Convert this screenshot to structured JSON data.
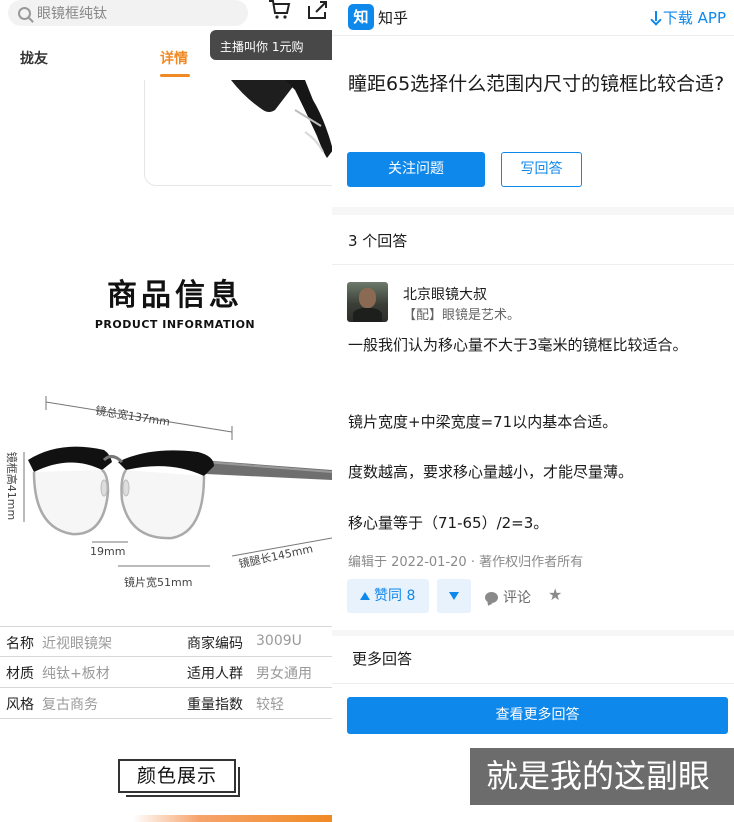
{
  "left_app": {
    "search_placeholder": "眼镜框纯钛",
    "tabs": [
      "拢友",
      "详情"
    ],
    "overlay_text": "主播叫你 1元购",
    "info_title": "商品信息",
    "info_subtitle": "PRODUCT INFORMATION",
    "dimensions": {
      "total_width": "镜总宽137mm",
      "frame_height": "镜框高41mm",
      "bridge": "19mm",
      "lens_width": "镜片宽51mm",
      "temple_length": "镜腿长145mm"
    },
    "specs": [
      {
        "k1": "名称",
        "v1": "近视眼镜架",
        "k2": "商家编码",
        "v2": "3009U"
      },
      {
        "k1": "材质",
        "v1": "纯钛+板材",
        "k2": "适用人群",
        "v2": "男女通用"
      },
      {
        "k1": "风格",
        "v1": "复古商务",
        "k2": "重量指数",
        "v2": "较轻"
      }
    ],
    "color_show": "颜色展示"
  },
  "zhihu": {
    "logo": "知",
    "app_name": "知乎",
    "download": "下载 APP",
    "question": "瞳距65选择什么范围内尺寸的镜框比较合适?",
    "follow_button": "关注问题",
    "answer_button": "写回答",
    "answer_count": "3 个回答",
    "author_name": "北京眼镜大叔",
    "author_bio": "【配】眼镜是艺术。",
    "paragraphs": [
      "一般我们认为移心量不大于3毫米的镜框比较适合。",
      "镜片宽度+中梁宽度=71以内基本合适。",
      "度数越高，要求移心量越小，才能尽量薄。",
      "移心量等于（71-65）/2=3。"
    ],
    "meta": "编辑于 2022-01-20 · 著作权归作者所有",
    "upvote": "赞同 8",
    "comment": "评论",
    "more_answers_title": "更多回答",
    "more_answers_button": "查看更多回答"
  },
  "video_subtitle": "就是我的这副眼",
  "colors": {
    "zhihu_blue": "#0f88eb",
    "accent_orange": "#f08a24"
  }
}
